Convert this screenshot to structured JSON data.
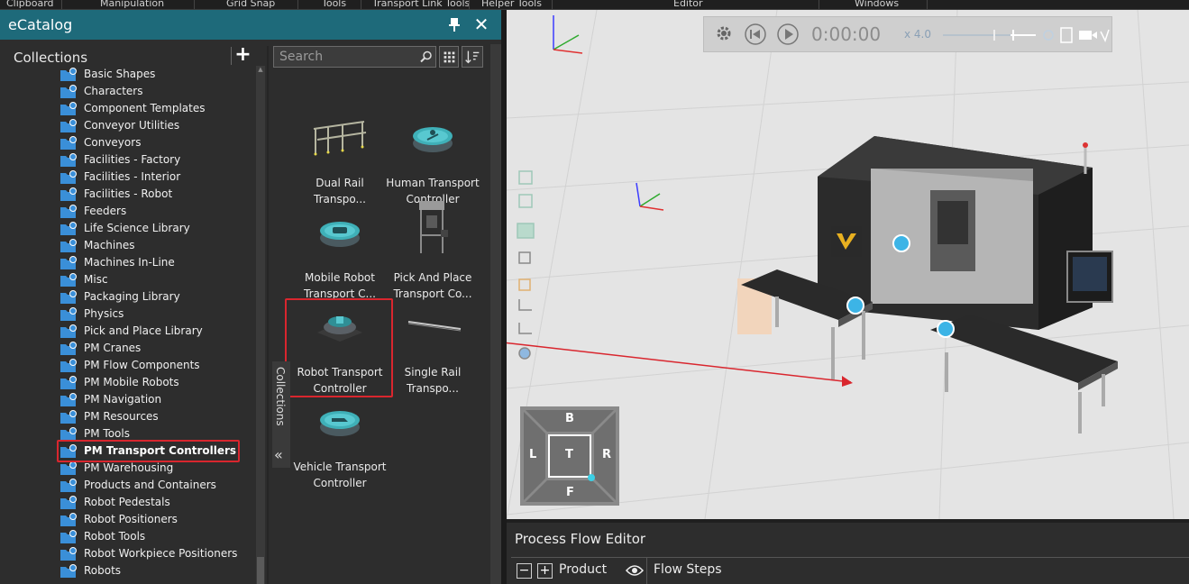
{
  "ribbon": {
    "groups": [
      "Clipboard",
      "Manipulation",
      "Grid Snap",
      "Tools",
      "Transport Link Tools",
      "Helper Tools",
      "Editor",
      "Windows"
    ]
  },
  "ecatalog": {
    "title": "eCatalog",
    "collections_label": "Collections",
    "collections": [
      "Basic Shapes",
      "Characters",
      "Component Templates",
      "Conveyor Utilities",
      "Conveyors",
      "Facilities - Factory",
      "Facilities - Interior",
      "Facilities - Robot",
      "Feeders",
      "Life Science Library",
      "Machines",
      "Machines In-Line",
      "Misc",
      "Packaging Library",
      "Physics",
      "Pick and Place Library",
      "PM Cranes",
      "PM Flow Components",
      "PM Mobile Robots",
      "PM Navigation",
      "PM Resources",
      "PM Tools",
      "PM Transport Controllers",
      "PM Warehousing",
      "Products and Containers",
      "Robot Pedestals",
      "Robot Positioners",
      "Robot Tools",
      "Robot Workpiece Positioners",
      "Robots"
    ],
    "selected_collection": "PM Transport Controllers",
    "search_placeholder": "Search",
    "side_tab": "Collections",
    "items": [
      {
        "line1": "Dual Rail",
        "line2": "Transpo..."
      },
      {
        "line1": "Human Transport",
        "line2": "Controller"
      },
      {
        "line1": "Mobile Robot",
        "line2": "Transport C..."
      },
      {
        "line1": "Pick And Place",
        "line2": "Transport Co..."
      },
      {
        "line1": "Robot Transport",
        "line2": "Controller"
      },
      {
        "line1": "Single Rail",
        "line2": "Transpo..."
      },
      {
        "line1": "Vehicle Transport",
        "line2": "Controller"
      }
    ]
  },
  "viewport": {
    "time": "0:00:00",
    "speed": "x 4.0",
    "viewcube": {
      "top": "B",
      "left": "L",
      "center": "T",
      "right": "R",
      "bottom": "F"
    }
  },
  "process_flow": {
    "title": "Process Flow Editor",
    "product_label": "Product",
    "flow_steps_label": "Flow Steps"
  },
  "colors": {
    "header_teal": "#1e6a7a",
    "highlight_red": "#d9262e",
    "folder_blue": "#3a8fd8",
    "node_cyan": "#3cb4e6"
  }
}
